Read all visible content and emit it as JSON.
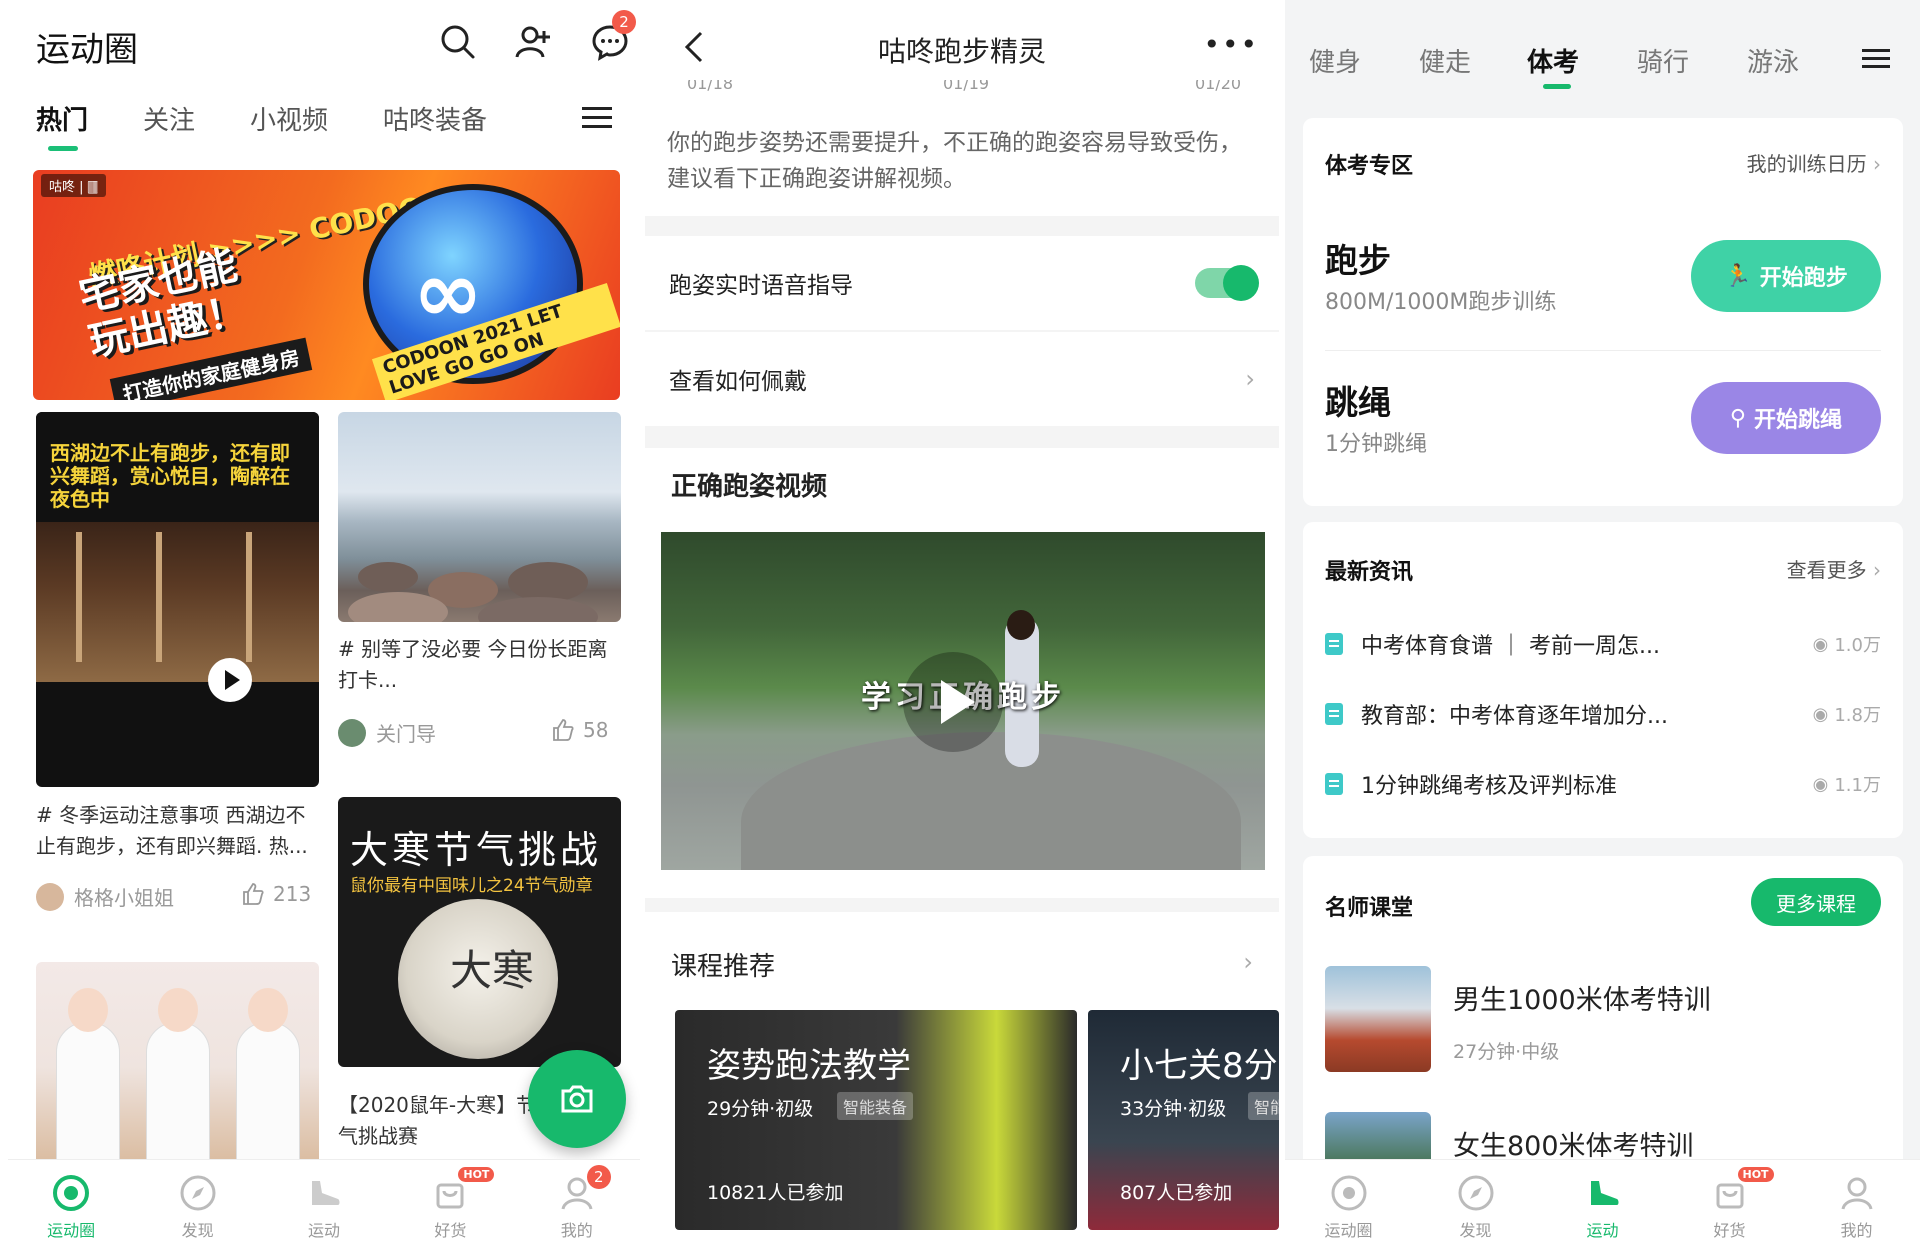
{
  "screen1": {
    "title": "运动圈",
    "chat_badge": "2",
    "tabs": [
      "热门",
      "关注",
      "小视频",
      "咕咚装备"
    ],
    "banner": {
      "logo": "咕咚 | 🀫",
      "line1": "燃咚计划 >>>> CODOON",
      "line2a": "宅家也能",
      "line2b": "玩出趣！",
      "line3": "打造你的家庭健身房",
      "go_text": "CODOON 2021 LET LOVE GO GO ON"
    },
    "posts": [
      {
        "caption": "西湖边不止有跑步，还有即兴舞蹈，赏心悦目，陶醉在夜色中",
        "text": "# 冬季运动注意事项 西湖边不止有跑步，还有即兴舞蹈. 热...",
        "user": "格格小姐姐",
        "likes": "213"
      },
      {
        "text": "# 别等了没必要 今日份长距离打卡...",
        "user": "关门导",
        "likes": "58"
      },
      {
        "title": "大寒节气挑战",
        "subtitle": "鼠你最有中国味儿之24节气勋章",
        "char": "大寒",
        "text": "【2020鼠年-大寒】节气挑战赛"
      }
    ],
    "nav": [
      {
        "label": "运动圈"
      },
      {
        "label": "发现"
      },
      {
        "label": "运动"
      },
      {
        "label": "好货",
        "hot": "HOT"
      },
      {
        "label": "我的",
        "badge": "2"
      }
    ]
  },
  "screen2": {
    "title": "咕咚跑步精灵",
    "axis_labels": [
      "01/18",
      "01/19",
      "01/20"
    ],
    "advice": "你的跑步姿势还需要提升，不正确的跑姿容易导致受伤，建议看下正确跑姿讲解视频。",
    "voice_row": "跑姿实时语音指导",
    "voice_on": true,
    "wear_row": "查看如何佩戴",
    "video_section": "正确跑姿视频",
    "video_caption": "学习正确跑步",
    "course_section": "课程推荐",
    "courses": [
      {
        "title": "姿势跑法教学",
        "meta": "29分钟·初级",
        "tag": "智能装备",
        "joined": "10821人已参加"
      },
      {
        "title": "小七关8分",
        "meta": "33分钟·初级",
        "tag": "智能",
        "joined": "807人已参加"
      }
    ]
  },
  "screen3": {
    "tabs": [
      "健身",
      "健走",
      "体考",
      "骑行",
      "游泳"
    ],
    "active_tab": "体考",
    "zone": {
      "title": "体考专区",
      "link": "我的训练日历",
      "items": [
        {
          "name": "跑步",
          "sub": "800M/1000M跑步训练",
          "button": "开始跑步"
        },
        {
          "name": "跳绳",
          "sub": "1分钟跳绳",
          "button": "开始跳绳"
        }
      ]
    },
    "news": {
      "title": "最新资讯",
      "link": "查看更多",
      "items": [
        {
          "title": "中考体育食谱 ｜ 考前一周怎...",
          "views": "1.0万"
        },
        {
          "title": "教育部：中考体育逐年增加分...",
          "views": "1.8万"
        },
        {
          "title": "1分钟跳绳考核及评判标准",
          "views": "1.1万"
        }
      ]
    },
    "teachers": {
      "title": "名师课堂",
      "button": "更多课程",
      "items": [
        {
          "title": "男生1000米体考特训",
          "meta": "27分钟·中级"
        },
        {
          "title": "女生800米体考特训",
          "meta": ""
        }
      ]
    },
    "nav": [
      {
        "label": "运动圈"
      },
      {
        "label": "发现"
      },
      {
        "label": "运动"
      },
      {
        "label": "好货",
        "hot": "HOT"
      },
      {
        "label": "我的"
      }
    ]
  },
  "colors": {
    "brand_green": "#17b96c",
    "run_button": "#3fd2a6",
    "rope_button": "#9a86e6",
    "badge_red": "#f25a4a"
  }
}
